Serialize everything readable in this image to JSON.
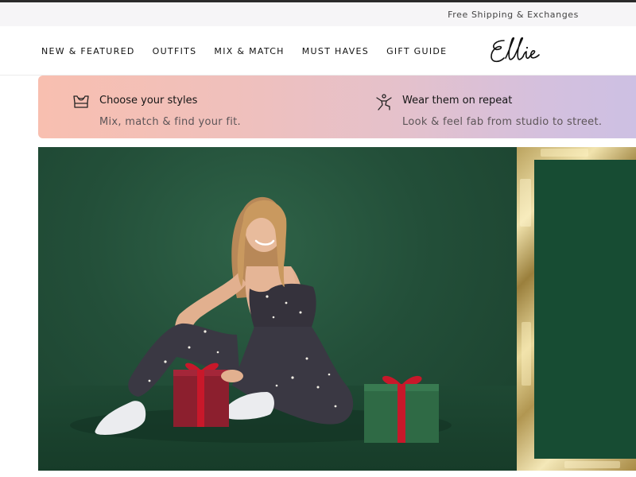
{
  "announcement": {
    "text": "Free Shipping & Exchanges"
  },
  "nav": {
    "links": [
      "NEW & FEATURED",
      "OUTFITS",
      "MIX & MATCH",
      "MUST HAVES",
      "GIFT GUIDE"
    ],
    "logo_text": "Ellie"
  },
  "benefits": [
    {
      "icon": "sports-bra-icon",
      "title": "Choose your styles",
      "subtitle": "Mix, match & find your fit."
    },
    {
      "icon": "yoga-pose-icon",
      "title": "Wear them on repeat",
      "subtitle": "Look & feel fab from studio to street."
    }
  ],
  "colors": {
    "hero_green": "#234f39",
    "gift_red": "#8c1f2e",
    "gift_green": "#2f6a45",
    "ribbon_red": "#c8182a",
    "gold_foil": "#d9c37f",
    "banner_pink": "#f8bfb0",
    "banner_lavender": "#cdc0e3"
  }
}
